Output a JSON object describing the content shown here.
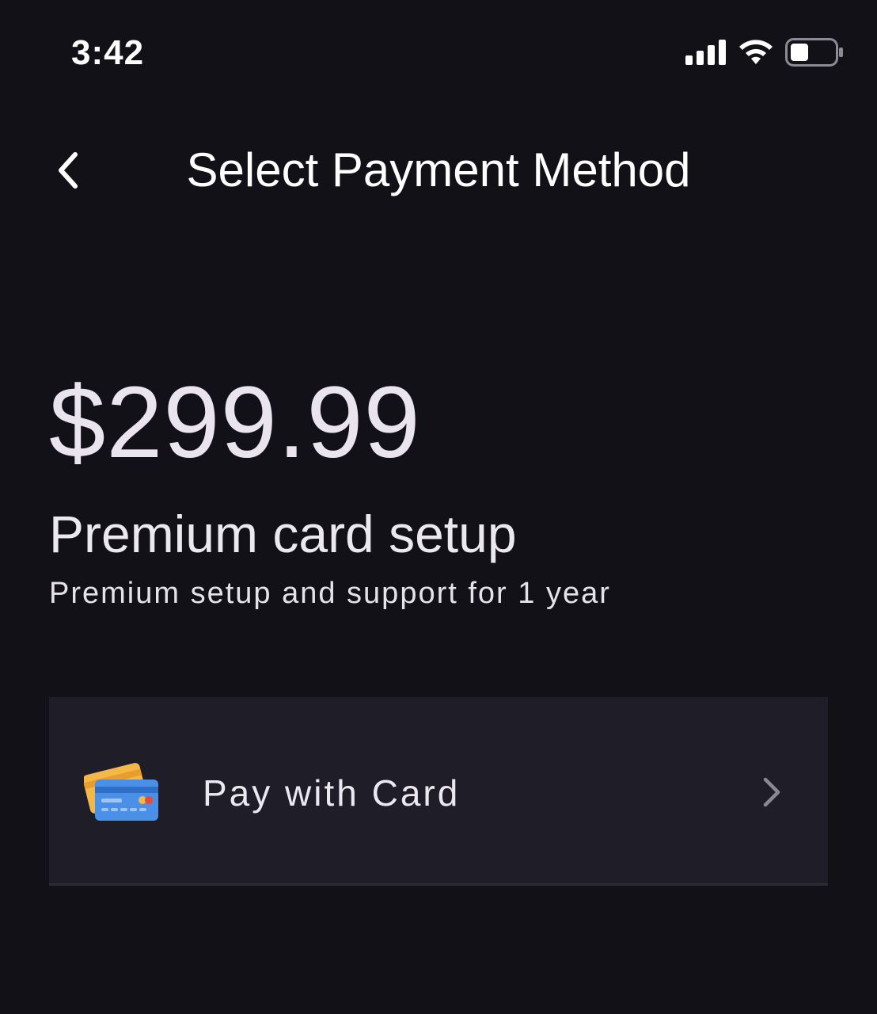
{
  "status_bar": {
    "time": "3:42",
    "icons": [
      "signal-icon",
      "wifi-icon",
      "battery-icon"
    ]
  },
  "header": {
    "back_icon": "chevron-left-icon",
    "title": "Select Payment Method"
  },
  "product": {
    "price": "$299.99",
    "title": "Premium card setup",
    "subtitle": "Premium setup and support for 1 year"
  },
  "payment_options": [
    {
      "label": "Pay with Card",
      "icon": "credit-card-icon",
      "chevron_icon": "chevron-right-icon"
    }
  ],
  "colors": {
    "background": "#131118",
    "row_background": "#1e1d28",
    "text_primary": "#ffffff",
    "text_secondary": "#e6e2ea"
  }
}
